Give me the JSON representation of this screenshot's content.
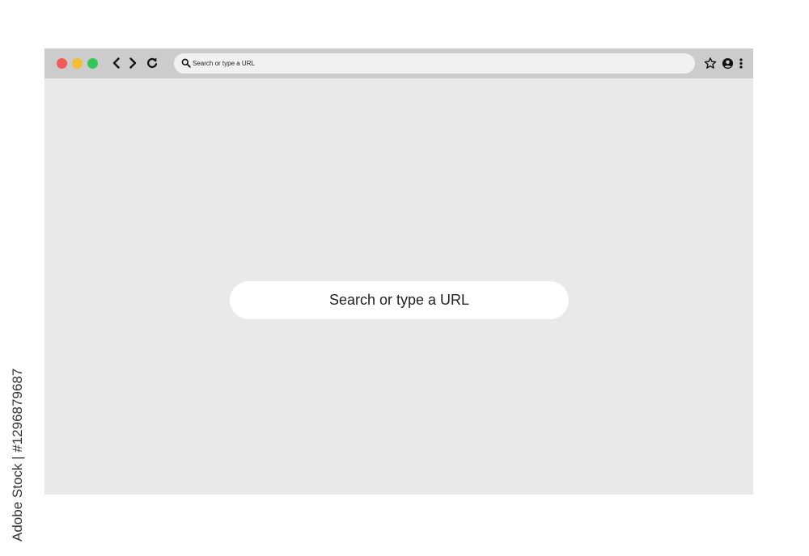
{
  "window": {
    "traffic_lights": [
      {
        "name": "close",
        "color": "#f05a5a"
      },
      {
        "name": "minimize",
        "color": "#f5bd32"
      },
      {
        "name": "maximize",
        "color": "#35c659"
      }
    ],
    "toolbar_color": "#cccccc",
    "content_color": "#e9e9e9"
  },
  "toolbar": {
    "nav_icons": [
      "chevron-left-icon",
      "chevron-right-icon",
      "reload-icon"
    ],
    "address_bar": {
      "placeholder": "Search or type a URL",
      "icon": "search-icon"
    },
    "right_icons": [
      "star-icon",
      "profile-icon",
      "more-vertical-icon"
    ]
  },
  "main": {
    "search_box": {
      "placeholder": "Search or type a URL"
    }
  },
  "watermark": {
    "label": "Adobe Stock | #1296879687"
  }
}
